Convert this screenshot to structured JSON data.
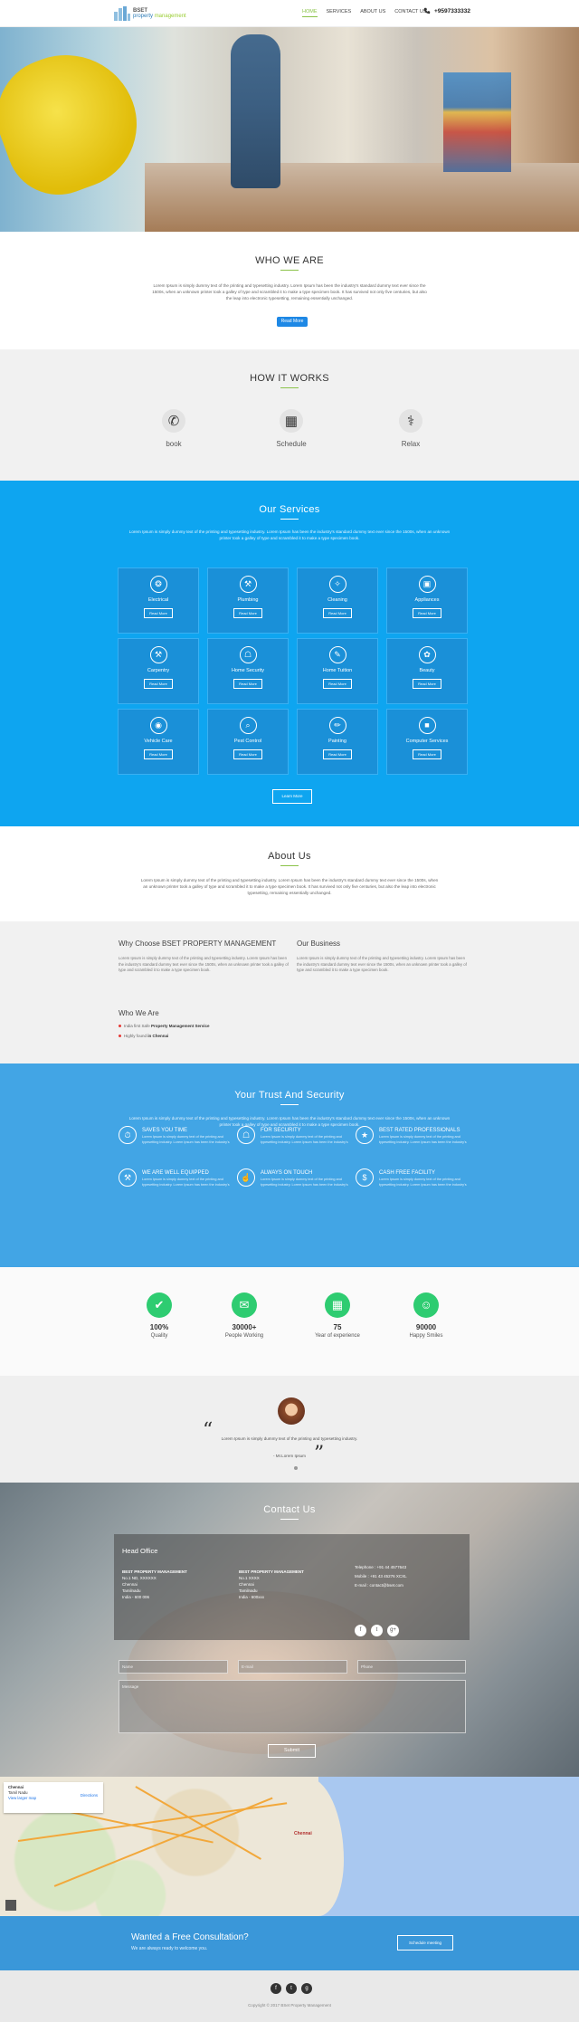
{
  "brand": {
    "line1": "BSET",
    "line2a": "property ",
    "line2b": "management"
  },
  "nav": {
    "items": [
      "HOME",
      "SERVICES",
      "ABOUT US",
      "CONTACT US"
    ],
    "active_index": 0,
    "phone": "+9597333332"
  },
  "hero": {
    "slides": 3,
    "active_slide": 0
  },
  "who": {
    "title": "WHO WE ARE",
    "text": "Lorem Ipsum is simply dummy text of the printing and typesetting industry. Lorem Ipsum has been the industry's standard dummy text ever since the 1500s, when an unknown printer took a galley of type and scrambled it to make a type specimen book. It has survived not only five centuries, but also the leap into electronic typesetting, remaining essentially unchanged.",
    "button": "Read More"
  },
  "how": {
    "title": "HOW IT WORKS",
    "steps": [
      {
        "label": "book",
        "icon": "phone-icon"
      },
      {
        "label": "Schedule",
        "icon": "calendar-icon"
      },
      {
        "label": "Relax",
        "icon": "relax-icon"
      }
    ]
  },
  "services": {
    "title": "Our Services",
    "text": "Lorem Ipsum is simply dummy text of the printing and typesetting industry. Lorem Ipsum has been the industry's standard dummy text ever since the 1500s, when an unknown printer took a galley of type and scrambled it to make a type specimen book.",
    "button_label": "Read More",
    "items": [
      {
        "label": "Electrical",
        "icon": "bulb-icon",
        "glyph": "❂"
      },
      {
        "label": "Plumbing",
        "icon": "pipe-icon",
        "glyph": "⚒"
      },
      {
        "label": "Cleaning",
        "icon": "spray-icon",
        "glyph": "✧"
      },
      {
        "label": "Appliances",
        "icon": "appliance-icon",
        "glyph": "▣"
      },
      {
        "label": "Carpentry",
        "icon": "saw-icon",
        "glyph": "⚒"
      },
      {
        "label": "Home Security",
        "icon": "lock-icon",
        "glyph": "☖"
      },
      {
        "label": "Home Tuition",
        "icon": "book-icon",
        "glyph": "✎"
      },
      {
        "label": "Beauty",
        "icon": "beauty-icon",
        "glyph": "✿"
      },
      {
        "label": "Vehicle Care",
        "icon": "car-icon",
        "glyph": "◉"
      },
      {
        "label": "Pest Control",
        "icon": "bug-icon",
        "glyph": "⌕"
      },
      {
        "label": "Painting",
        "icon": "brush-icon",
        "glyph": "✏"
      },
      {
        "label": "Computer Services",
        "icon": "computer-icon",
        "glyph": "■"
      }
    ],
    "more_button": "Learn More"
  },
  "about": {
    "title": "About Us",
    "text": "Lorem Ipsum is simply dummy text of the printing and typesetting industry. Lorem Ipsum has been the industry's standard dummy text ever since the 1500s, when an unknown printer took a galley of type and scrambled it to make a type specimen book. It has survived not only five centuries, but also the leap into electronic typesetting, remaining essentially unchanged."
  },
  "why": {
    "choose_title": "Why Choose BSET PROPERTY MANAGEMENT",
    "choose_text": "Lorem Ipsum is simply dummy text of the printing and typesetting industry. Lorem Ipsum has been the industry's standard dummy text ever since the 1500s, when an unknown printer took a galley of type and scrambled it to make a type specimen book.",
    "business_title": "Our Business",
    "business_text": "Lorem Ipsum is simply dummy text of the printing and typesetting industry. Lorem Ipsum has been the industry's standard dummy text ever since the 1500s, when an unknown printer took a galley of type and scrambled it to make a type specimen book.",
    "who_title": "Who We Are",
    "bullets": [
      {
        "prefix": "India first Safe ",
        "bold": "Property Management Service"
      },
      {
        "prefix": "Highly found ",
        "bold": "in Chennai"
      }
    ]
  },
  "trust": {
    "title": "Your Trust And Security",
    "text": "Lorem Ipsum is simply dummy text of the printing and typesetting industry. Lorem Ipsum has been the industry's standard dummy text ever since the 1500s, when an unknown printer took a galley of type and scrambled it to make a type specimen book.",
    "items": [
      {
        "title": "SAVES YOU TIME",
        "icon": "clock-icon",
        "glyph": "⏱",
        "text": "Lorem Ipsum is simply dummy text of the printing and typesetting industry. Lorem Ipsum has been the industry's"
      },
      {
        "title": "FOR SECURITY",
        "icon": "shield-icon",
        "glyph": "☖",
        "text": "Lorem Ipsum is simply dummy text of the printing and typesetting industry. Lorem Ipsum has been the industry's"
      },
      {
        "title": "BEST RATED PROFESSIONALS",
        "icon": "star-icon",
        "glyph": "★",
        "text": "Lorem Ipsum is simply dummy text of the printing and typesetting industry. Lorem Ipsum has been the industry's"
      },
      {
        "title": "WE ARE WELL EQUIPPED",
        "icon": "tools-icon",
        "glyph": "⚒",
        "text": "Lorem Ipsum is simply dummy text of the printing and typesetting industry. Lorem Ipsum has been the industry's"
      },
      {
        "title": "ALWAYS ON TOUCH",
        "icon": "touch-icon",
        "glyph": "☝",
        "text": "Lorem Ipsum is simply dummy text of the printing and typesetting industry. Lorem Ipsum has been the industry's"
      },
      {
        "title": "CASH FREE FACILITY",
        "icon": "cash-icon",
        "glyph": "$",
        "text": "Lorem Ipsum is simply dummy text of the printing and typesetting industry. Lorem Ipsum has been the industry's"
      }
    ]
  },
  "stats": [
    {
      "value": "100%",
      "label": "Quality",
      "icon": "thumbs-up-icon",
      "glyph": "✔"
    },
    {
      "value": "30000+",
      "label": "People Working",
      "icon": "chat-icon",
      "glyph": "✉"
    },
    {
      "value": "75",
      "label": "Year of experience",
      "icon": "calendar-icon",
      "glyph": "▦"
    },
    {
      "value": "90000",
      "label": "Happy Smiles",
      "icon": "smile-icon",
      "glyph": "☺"
    }
  ],
  "testimonial": {
    "quote": "Lorem Ipsum is simply dummy text of the printing and typesetting industry.",
    "author": "- Mr.Lorem Ipsum"
  },
  "contact": {
    "title": "Contact Us",
    "office_title": "Head Office",
    "col1": [
      "BEST PROPERTY MANAGEMENT",
      "No.1 ND, XXXXXX",
      "Chennai",
      "Tamilnadu",
      "India - 600 006"
    ],
    "col2": [
      "BEST PROPERTY MANAGEMENT",
      "No.1 XXXX",
      "Chennai",
      "Tamilnadu",
      "India - 600xxx"
    ],
    "col3": [
      "Telephone : +91 44 4577643",
      "Mobile : +91 43 45276 XCXL",
      "E-mail : contact@bset.com"
    ],
    "name_placeholder": "Name",
    "email_placeholder": "E-mail",
    "phone_placeholder": "Phone",
    "message_placeholder": "Message",
    "submit": "Submit"
  },
  "map": {
    "card_title": "Chennai",
    "card_sub": "Tamil Nadu",
    "card_link": "View larger map",
    "directions": "Directions",
    "city": "Chennai"
  },
  "cta": {
    "title": "Wanted a Free Consultation?",
    "text": "We are always ready to welcome you.",
    "button": "Schedule meeting"
  },
  "footer": {
    "copyright": "Copyright © 2017 BSet Property Management"
  }
}
